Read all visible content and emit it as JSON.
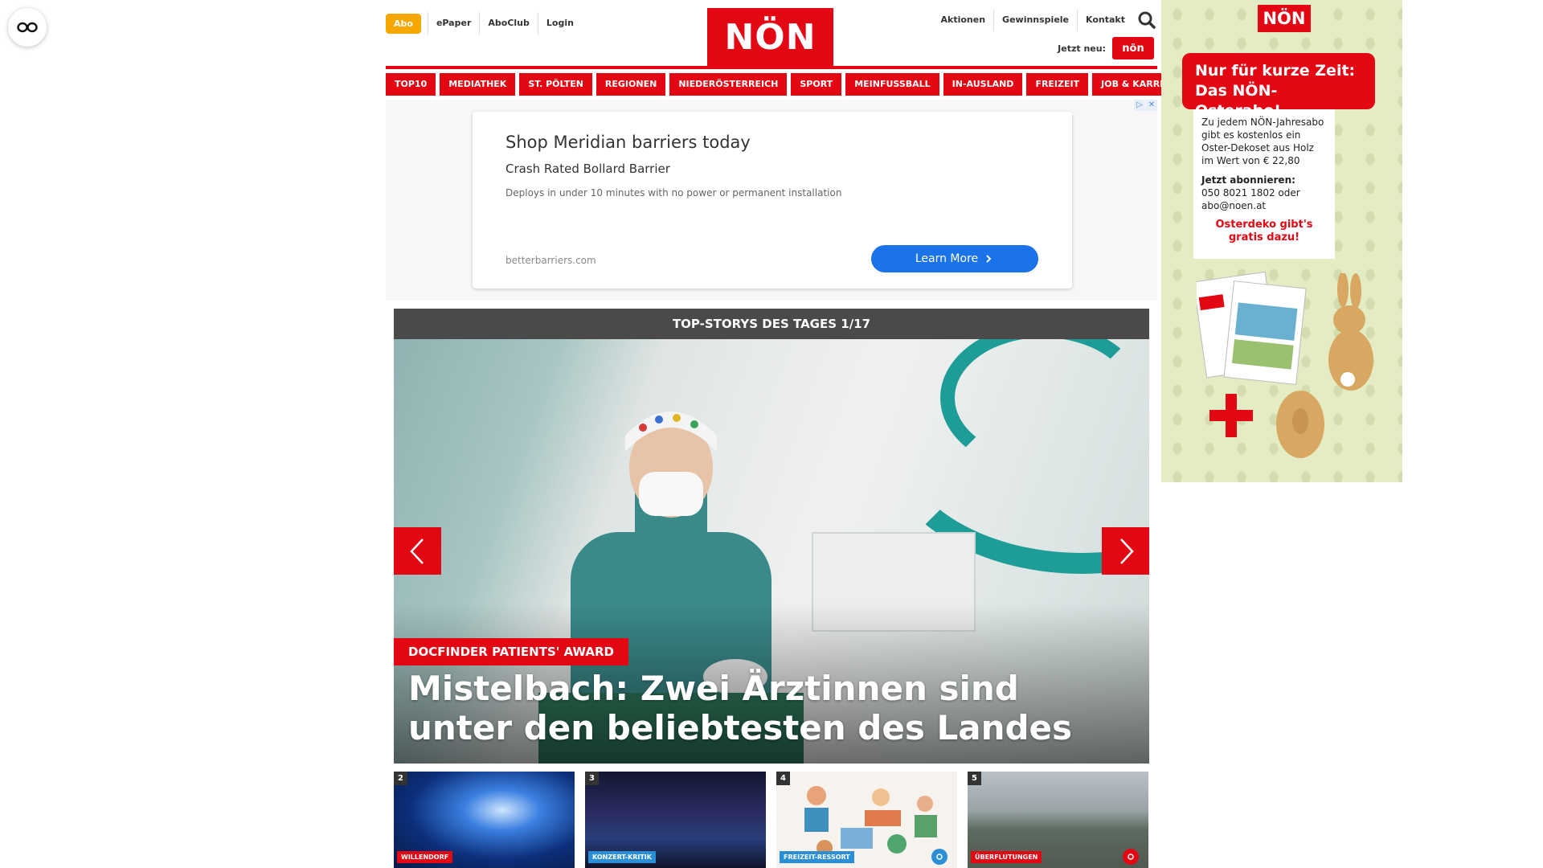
{
  "header": {
    "abo_label": "Abo",
    "left_links": [
      "ePaper",
      "AboClub",
      "Login"
    ],
    "logo_text": "NÖN",
    "right_links": [
      "Aktionen",
      "Gewinnspiele",
      "Kontakt"
    ],
    "jetzt_label": "Jetzt neu:",
    "jetzt_logo_text": "nön"
  },
  "nav": {
    "items": [
      "TOP10",
      "MEDIATHEK",
      "ST. PÖLTEN",
      "REGIONEN",
      "NIEDERÖSTERREICH",
      "SPORT",
      "MEINFUSSBALL",
      "IN-AUSLAND",
      "FREIZEIT",
      "JOB & KARRIERE"
    ]
  },
  "ad": {
    "title": "Shop Meridian barriers today",
    "subtitle": "Crash Rated Bollard Barrier",
    "description": "Deploys in under 10 minutes with no power or permanent installation",
    "domain": "betterbarriers.com",
    "cta": "Learn More"
  },
  "top_stories": {
    "header": "TOP-STORYS DES TAGES 1/17",
    "hero_tag": "DOCFINDER PATIENTS' AWARD",
    "hero_title": "Mistelbach: Zwei Ärztinnen sind unter den beliebtesten des Landes",
    "thumbs": [
      {
        "num": "2",
        "tag": "WILLENDORF",
        "tag_color": "#e30613"
      },
      {
        "num": "3",
        "tag": "KONZERT-KRITIK",
        "tag_color": "#2a8fd6"
      },
      {
        "num": "4",
        "tag": "FREIZEIT-RESSORT",
        "tag_color": "#2a8fd6"
      },
      {
        "num": "5",
        "tag": "ÜBERFLUTUNGEN",
        "tag_color": "#e30613"
      }
    ]
  },
  "sidebar_ad": {
    "logo": "NÖN",
    "banner": "Nur für kurze Zeit: Das NÖN-Osterabo!",
    "body": "Zu jedem NÖN-Jahresabo gibt es kostenlos ein Oster-Dekoset aus Holz im Wert von € 22,80",
    "cta_title": "Jetzt abonnieren:",
    "cta_body": "050 8021 1802 oder abo@noen.at",
    "red_note": "Osterdeko gibt's gratis dazu!"
  },
  "colors": {
    "brand_red": "#e30613",
    "abo_orange": "#f7a800",
    "ad_button_blue": "#1a73e8",
    "header_gray": "#4a4a4a"
  },
  "icons": [
    "glasses-icon",
    "search-icon",
    "chevron-left-icon",
    "chevron-right-icon",
    "chevron-right-small-icon",
    "camera-icon",
    "adchoices-icon",
    "close-icon"
  ]
}
